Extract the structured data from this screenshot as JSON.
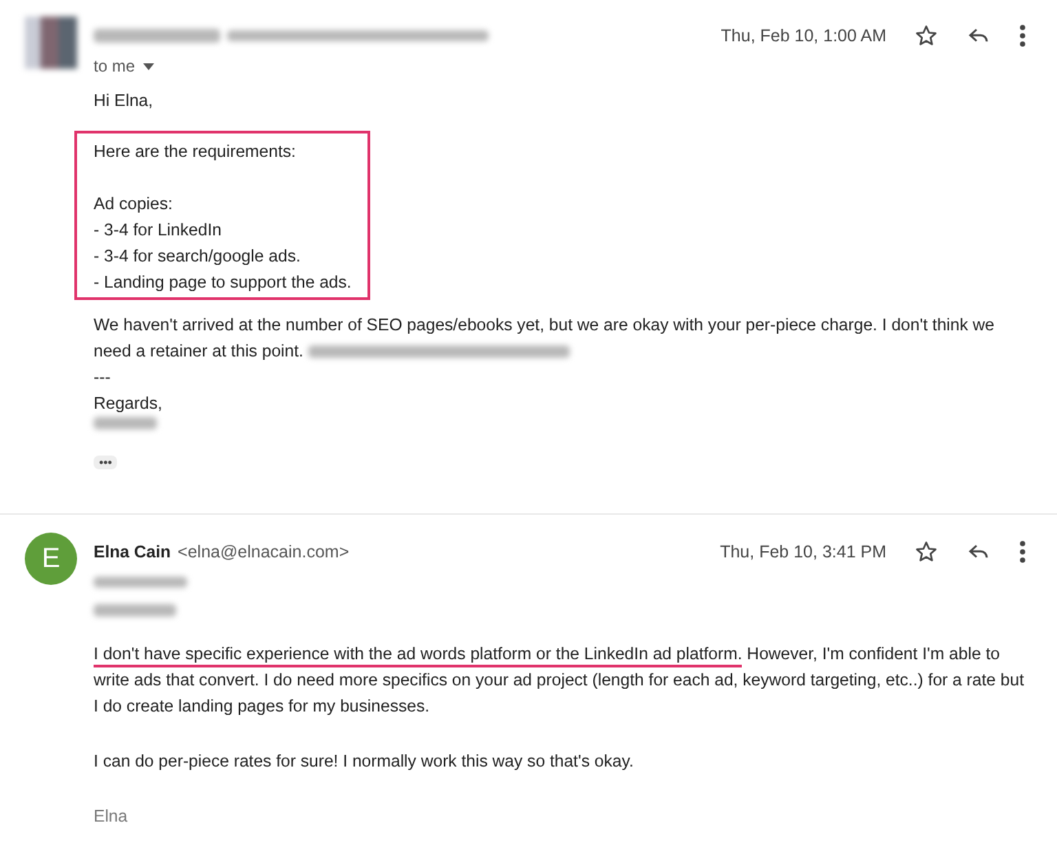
{
  "messages": [
    {
      "avatar": {
        "kind": "blurred"
      },
      "sender": {
        "kind": "blurred"
      },
      "date": "Thu, Feb 10, 1:00 AM",
      "recipient": {
        "kind": "text",
        "text": "to me"
      },
      "body": [
        {
          "kind": "text",
          "text": "Hi Elna,"
        },
        {
          "kind": "boxed",
          "color": "#e0336b",
          "paragraphs": [
            [
              "Here are the requirements:"
            ],
            [
              "Ad copies:",
              "- 3-4 for LinkedIn",
              "- 3-4 for search/google ads.",
              "- Landing page to support the ads."
            ]
          ]
        },
        {
          "kind": "paragraph",
          "segments": [
            {
              "text": "We haven't arrived at the number of SEO pages/ebooks yet, but we are okay with your per-piece charge. I don't think we need a retainer at this point.",
              "underlined": false
            },
            {
              "kind": "redacted"
            }
          ]
        },
        {
          "kind": "lines",
          "lines": [
            "---",
            "Regards,"
          ]
        },
        {
          "kind": "redacted"
        },
        {
          "kind": "ellipsis",
          "text": "•••"
        }
      ]
    },
    {
      "avatar": {
        "kind": "letter",
        "letter": "E",
        "color": "#5f9e3a"
      },
      "sender": {
        "kind": "text",
        "name": "Elna Cain",
        "email": "<elna@elnacain.com>"
      },
      "date": "Thu, Feb 10, 3:41 PM",
      "recipient": {
        "kind": "blurred"
      },
      "body": [
        {
          "kind": "redacted"
        },
        {
          "kind": "paragraph",
          "segments": [
            {
              "text": "I don't have specific experience with the ad words platform or the LinkedIn ad platform.",
              "underlined": true
            },
            {
              "text": " However, I'm confident I'm able to write ads that convert. I do need more specifics on your ad project (length for each ad, keyword targeting, etc..) for a rate but I do create landing pages for my businesses.",
              "underlined": false
            }
          ]
        },
        {
          "kind": "paragraph",
          "segments": [
            {
              "text": "I can do per-piece rates for sure! I normally work this way so that's okay.",
              "underlined": false
            }
          ]
        },
        {
          "kind": "signature",
          "text": "Elna"
        }
      ]
    }
  ]
}
